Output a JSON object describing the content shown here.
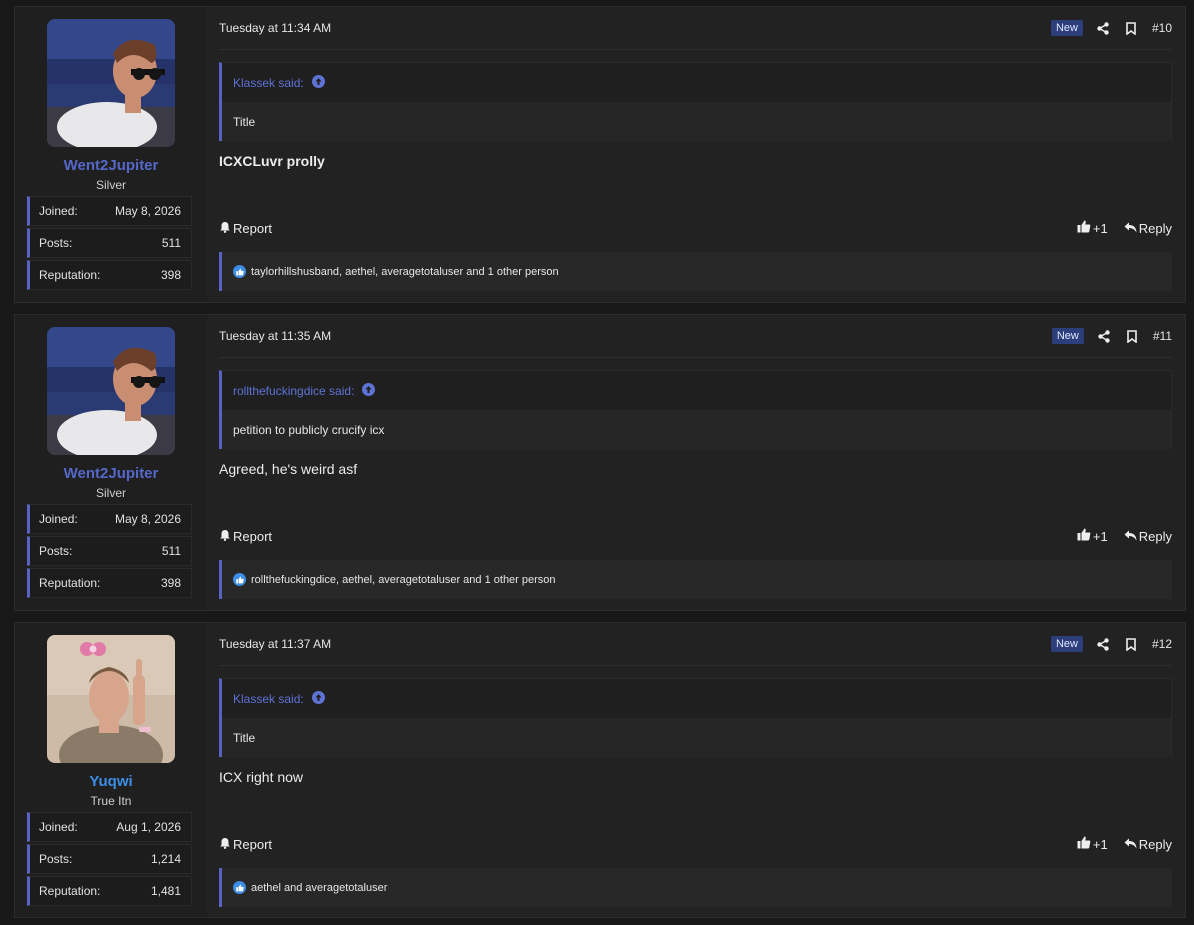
{
  "colors": {
    "accent": "#5763c4",
    "username_purple": "#5568c9",
    "username_blue": "#3d8ee6",
    "badge_bg": "#2c3f7c"
  },
  "stat_labels": {
    "joined": "Joined:",
    "posts": "Posts:",
    "reputation": "Reputation:"
  },
  "posts": [
    {
      "timestamp": "Tuesday at 11:34 AM",
      "badge": "New",
      "number": "#10",
      "user": {
        "name": "Went2Jupiter",
        "title": "Silver",
        "joined": "May 8, 2026",
        "posts": "511",
        "reputation": "398"
      },
      "quote": {
        "author": "Klassek said:",
        "text": "Title"
      },
      "body": "ICXCLuvr prolly",
      "report": "Report",
      "plus_one": "+1",
      "reply": "Reply",
      "reactions": "taylorhillshusband, aethel, averagetotaluser and 1 other person"
    },
    {
      "timestamp": "Tuesday at 11:35 AM",
      "badge": "New",
      "number": "#11",
      "user": {
        "name": "Went2Jupiter",
        "title": "Silver",
        "joined": "May 8, 2026",
        "posts": "511",
        "reputation": "398"
      },
      "quote": {
        "author": "rollthefuckingdice said:",
        "text": "petition to publicly crucify icx"
      },
      "body": "Agreed, he's weird asf",
      "report": "Report",
      "plus_one": "+1",
      "reply": "Reply",
      "reactions": "rollthefuckingdice, aethel, averagetotaluser and 1 other person"
    },
    {
      "timestamp": "Tuesday at 11:37 AM",
      "badge": "New",
      "number": "#12",
      "user": {
        "name": "Yuqwi",
        "title": "True Itn",
        "joined": "Aug 1, 2026",
        "posts": "1,214",
        "reputation": "1,481"
      },
      "quote": {
        "author": "Klassek said:",
        "text": "Title"
      },
      "body": "ICX right now",
      "report": "Report",
      "plus_one": "+1",
      "reply": "Reply",
      "reactions": "aethel and averagetotaluser"
    }
  ]
}
